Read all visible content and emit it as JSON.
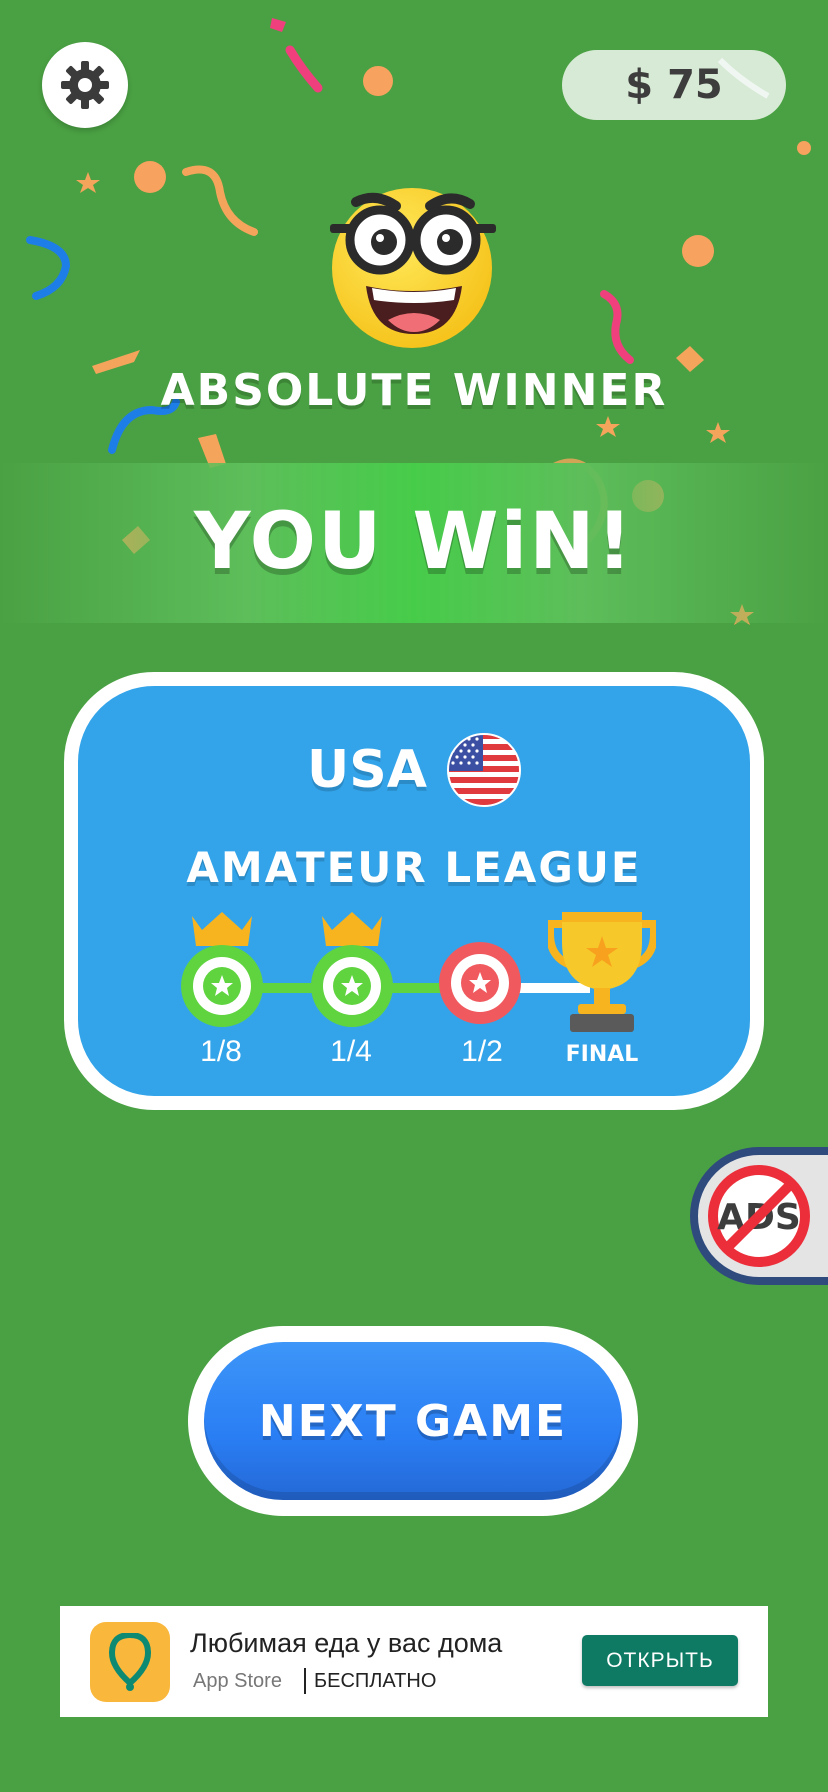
{
  "header": {
    "currency_symbol": "$",
    "coins": "75"
  },
  "result": {
    "title": "ABSOLUTE WINNER",
    "banner": "YOU WiN!"
  },
  "league": {
    "country": "USA",
    "name": "AMATEUR LEAGUE",
    "stages": [
      {
        "label": "1/8",
        "state": "won"
      },
      {
        "label": "1/4",
        "state": "won"
      },
      {
        "label": "1/2",
        "state": "current"
      },
      {
        "label": "FINAL",
        "state": "trophy"
      }
    ]
  },
  "buttons": {
    "no_ads": "ADS",
    "next_game": "NEXT GAME"
  },
  "ad": {
    "title": "Любимая еда у вас дома",
    "store": "App Store",
    "price": "БЕСПЛАТНО",
    "cta": "ОТКРЫТЬ"
  },
  "colors": {
    "background": "#4aa143",
    "card": "#33a4ea",
    "won_stage": "#5fd43f",
    "current_stage": "#f05a5f",
    "next_button": "#2a7ef4",
    "ad_button": "#0e7a64"
  }
}
